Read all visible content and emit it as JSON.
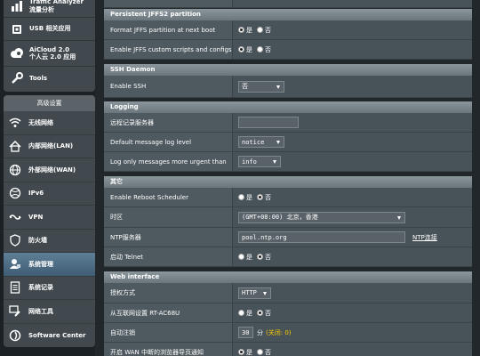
{
  "sidebar": {
    "top_items": [
      {
        "label": "Traffic Analyzer\n流量分析",
        "icon": "traffic-analyzer-icon"
      },
      {
        "label": "USB 相关应用",
        "icon": "usb-icon"
      },
      {
        "label": "AiCloud 2.0\n个人云 2.0 应用",
        "icon": "aicloud-icon"
      },
      {
        "label": "Tools",
        "icon": "wrench-icon"
      }
    ],
    "advanced_header": "高级设置",
    "advanced_items": [
      {
        "label": "无线网络",
        "icon": "wifi-icon"
      },
      {
        "label": "内部网络(LAN)",
        "icon": "home-icon"
      },
      {
        "label": "外部网络(WAN)",
        "icon": "globe-icon"
      },
      {
        "label": "IPv6",
        "icon": "ipv6-globe-icon"
      },
      {
        "label": "VPN",
        "icon": "vpn-icon"
      },
      {
        "label": "防火墙",
        "icon": "firewall-shield-icon"
      },
      {
        "label": "系统管理",
        "icon": "admin-user-icon",
        "active": true
      },
      {
        "label": "系统记录",
        "icon": "log-document-icon"
      },
      {
        "label": "网络工具",
        "icon": "network-tools-icon"
      },
      {
        "label": "Software Center",
        "icon": "software-center-icon"
      }
    ]
  },
  "sections": {
    "jffs": {
      "title": "Persistent JFFS2 partition",
      "format_label": "Format JFFS partition at next boot",
      "scripts_label": "Enable JFFS custom scripts and configs"
    },
    "ssh": {
      "title": "SSH Daemon",
      "enable_label": "Enable SSH",
      "enable_value": "否"
    },
    "logging": {
      "title": "Logging",
      "remote_label": "远程记录服务器",
      "remote_value": "",
      "default_level_label": "Default message log level",
      "default_level_value": "notice",
      "urgent_label": "Log only messages more urgent than",
      "urgent_value": "info"
    },
    "other": {
      "title": "其它",
      "reboot_label": "Enable Reboot Scheduler",
      "timezone_label": "时区",
      "timezone_value": "(GMT+08:00) 北京，香港",
      "ntp_label": "NTP服务器",
      "ntp_value": "pool.ntp.org",
      "ntp_link": "NTP连接",
      "telnet_label": "启动 Telnet"
    },
    "web": {
      "title": "Web interface",
      "auth_label": "授权方式",
      "auth_value": "HTTP",
      "wan_access_label": "从互联网设置 RT-AC68U",
      "logout_label": "自动注销",
      "logout_value": "30",
      "logout_unit": "分",
      "logout_hint": "(关闭: 0)",
      "redirect_label": "开启 WAN 中断的浏览器导页通知"
    }
  },
  "radio": {
    "yes": "是",
    "no": "否"
  }
}
